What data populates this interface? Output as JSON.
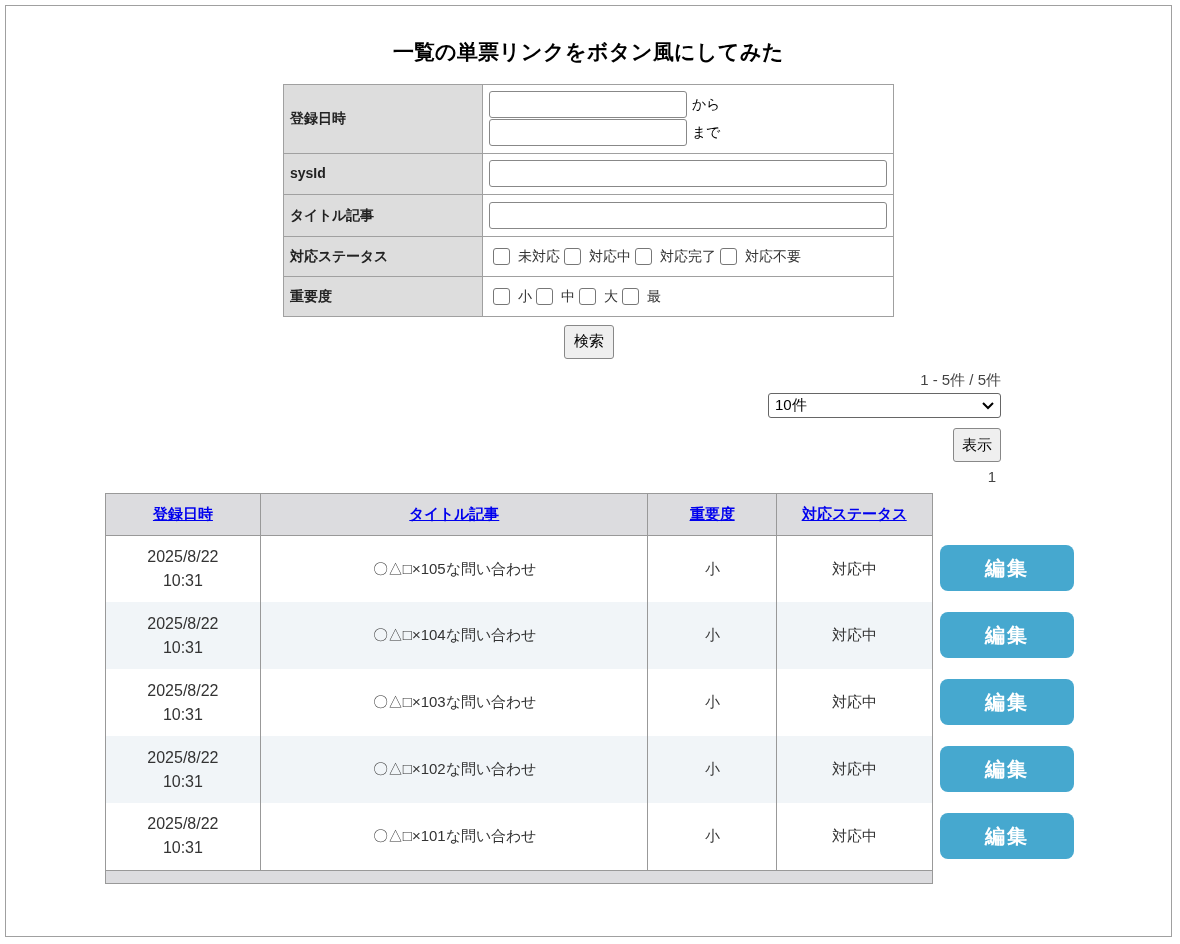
{
  "title": "一覧の単票リンクをボタン風にしてみた",
  "search_form": {
    "date": {
      "label": "登録日時",
      "from_suffix": "から",
      "to_suffix": "まで"
    },
    "sysid": {
      "label": "sysId"
    },
    "title_field": {
      "label": "タイトル記事"
    },
    "status": {
      "label": "対応ステータス",
      "options": [
        {
          "label": "未対応",
          "checked": false
        },
        {
          "label": "対応中",
          "checked": false
        },
        {
          "label": "対応完了",
          "checked": false
        },
        {
          "label": "対応不要",
          "checked": false
        }
      ]
    },
    "priority": {
      "label": "重要度",
      "options": [
        {
          "label": "小",
          "checked": false
        },
        {
          "label": "中",
          "checked": false
        },
        {
          "label": "大",
          "checked": false
        },
        {
          "label": "最",
          "checked": false
        }
      ]
    },
    "search_button": "検索"
  },
  "paging": {
    "count": "1 - 5件 / 5件",
    "page_size": "10件",
    "show_button": "表示",
    "pages": [
      "1"
    ]
  },
  "table": {
    "columns": [
      "登録日時",
      "タイトル記事",
      "重要度",
      "対応ステータス"
    ],
    "rows": [
      {
        "date": "2025/8/22 10:31",
        "title": "〇△□×105な問い合わせ",
        "priority": "小",
        "status": "対応中",
        "action": "編集"
      },
      {
        "date": "2025/8/22 10:31",
        "title": "〇△□×104な問い合わせ",
        "priority": "小",
        "status": "対応中",
        "action": "編集"
      },
      {
        "date": "2025/8/22 10:31",
        "title": "〇△□×103な問い合わせ",
        "priority": "小",
        "status": "対応中",
        "action": "編集"
      },
      {
        "date": "2025/8/22 10:31",
        "title": "〇△□×102な問い合わせ",
        "priority": "小",
        "status": "対応中",
        "action": "編集"
      },
      {
        "date": "2025/8/22 10:31",
        "title": "〇△□×101な問い合わせ",
        "priority": "小",
        "status": "対応中",
        "action": "編集"
      }
    ]
  }
}
